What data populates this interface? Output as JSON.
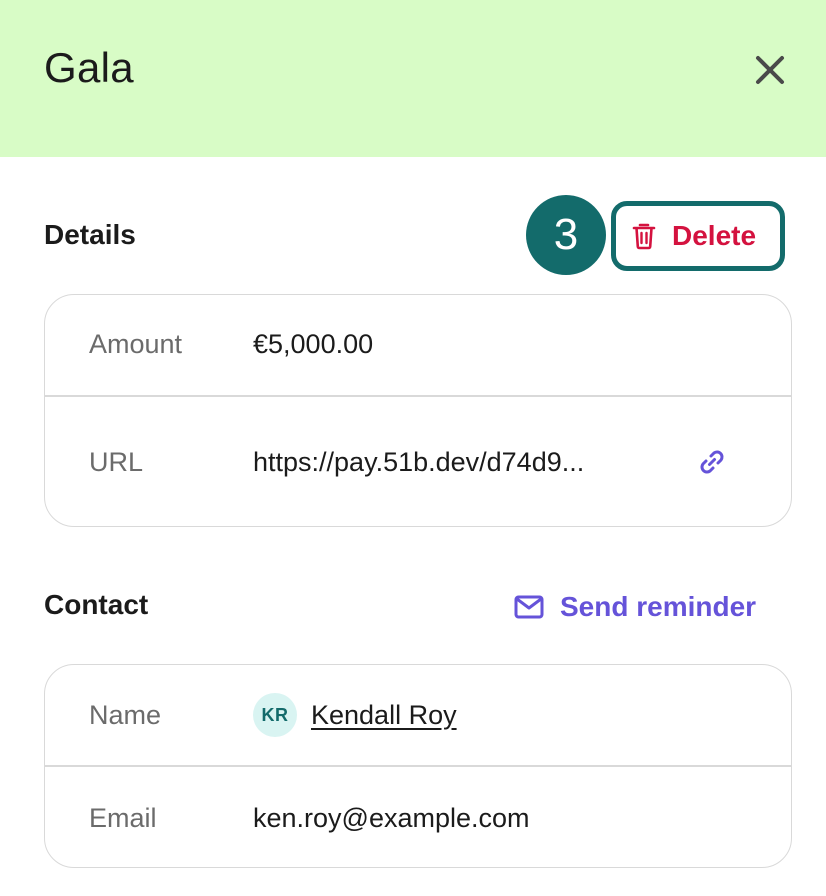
{
  "header": {
    "title": "Gala",
    "close_icon": "close-icon",
    "background": "#d8fcc6"
  },
  "details": {
    "title": "Details",
    "step_badge": "3",
    "delete_label": "Delete",
    "delete_icon": "trash-icon",
    "rows": [
      {
        "label": "Amount",
        "value": "€5,000.00"
      },
      {
        "label": "URL",
        "value": "https://pay.51b.dev/d74d9...",
        "icon": "link-icon"
      }
    ]
  },
  "contact": {
    "title": "Contact",
    "send_reminder_label": "Send reminder",
    "send_reminder_icon": "envelope-icon",
    "rows": [
      {
        "label": "Name",
        "avatar_initials": "KR",
        "value": "Kendall Roy"
      },
      {
        "label": "Email",
        "value": "ken.roy@example.com"
      }
    ]
  },
  "colors": {
    "accent_teal": "#136b6b",
    "danger_red": "#d4123f",
    "link_purple": "#6553d9",
    "border": "#d9d9d9"
  }
}
